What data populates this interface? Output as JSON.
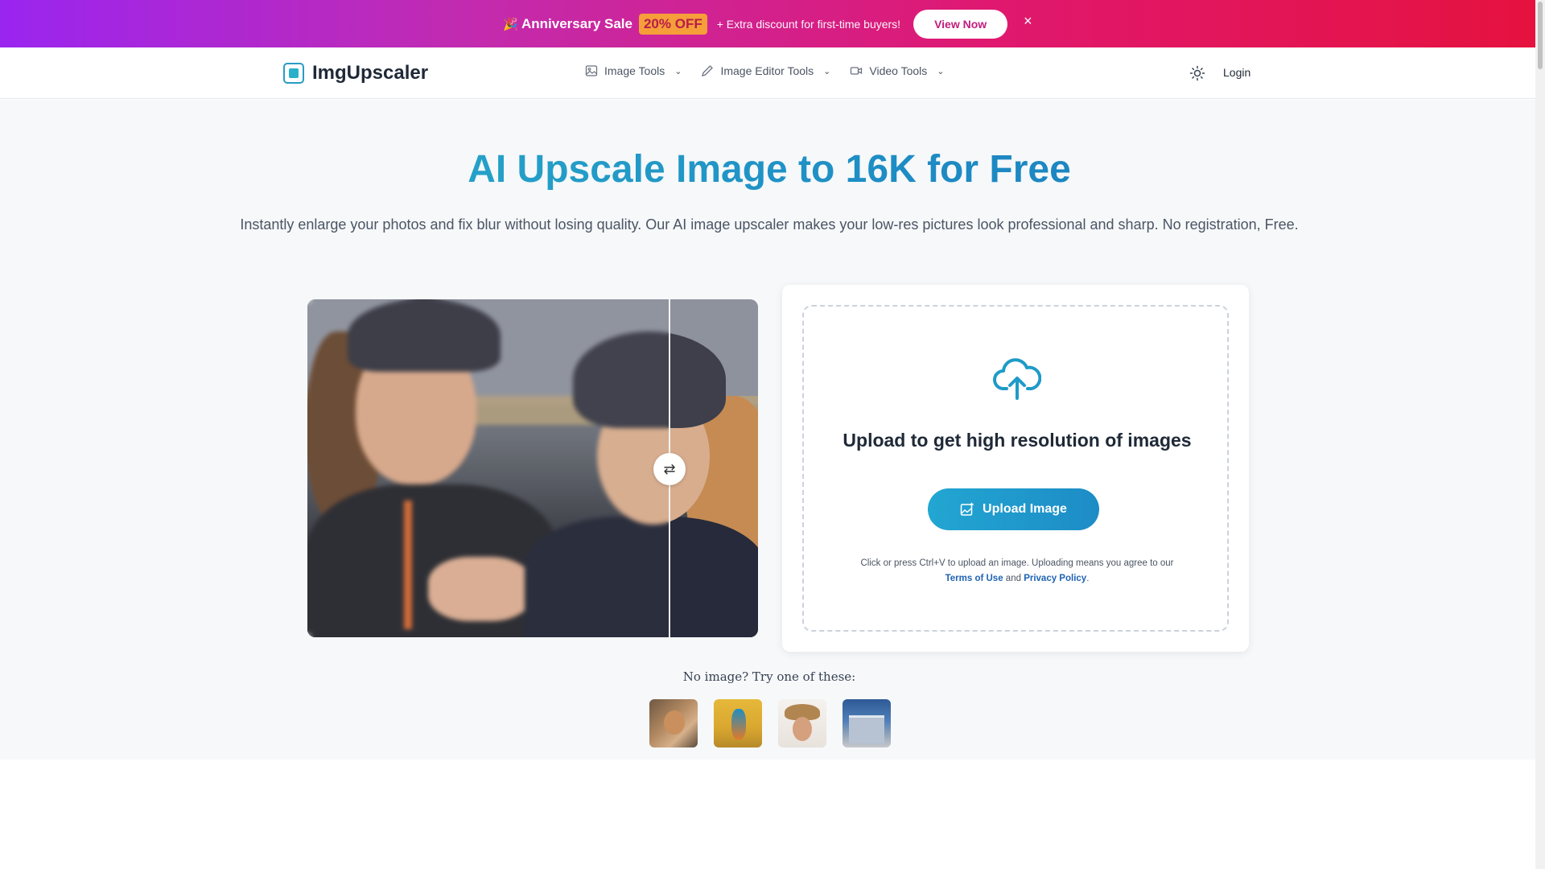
{
  "promo": {
    "sale_label": "Anniversary Sale",
    "badge": "20% OFF",
    "extra": "+ Extra discount for first-time buyers!",
    "cta": "View Now",
    "close": "×"
  },
  "nav": {
    "brand": "ImgUpscaler",
    "menu": [
      {
        "label": "Image Tools",
        "icon": "image-icon"
      },
      {
        "label": "Image Editor Tools",
        "icon": "pencil-icon"
      },
      {
        "label": "Video Tools",
        "icon": "video-icon"
      }
    ],
    "login": "Login",
    "theme_icon": "sun-icon"
  },
  "hero": {
    "title": "AI Upscale Image to 16K for Free",
    "subtitle": "Instantly enlarge your photos and fix blur without losing quality. Our AI image upscaler makes your low-res pictures look professional and sharp. No registration, Free."
  },
  "compare": {
    "handle_icon": "⇄"
  },
  "upload": {
    "title": "Upload to get high resolution of images",
    "button": "Upload Image",
    "note_prefix": "Click or press Ctrl+V to upload an image. Uploading means you agree to our ",
    "terms": "Terms of Use",
    "and": " and ",
    "privacy": "Privacy Policy",
    "period": "."
  },
  "samples": {
    "label": "No image? Try one of these:",
    "items": [
      "sample-dog",
      "sample-bird",
      "sample-woman",
      "sample-building"
    ]
  },
  "colors": {
    "accent": "#1d8cc6",
    "promo_start": "#9a25f0",
    "promo_end": "#e5123f",
    "badge": "#f59e3a"
  }
}
